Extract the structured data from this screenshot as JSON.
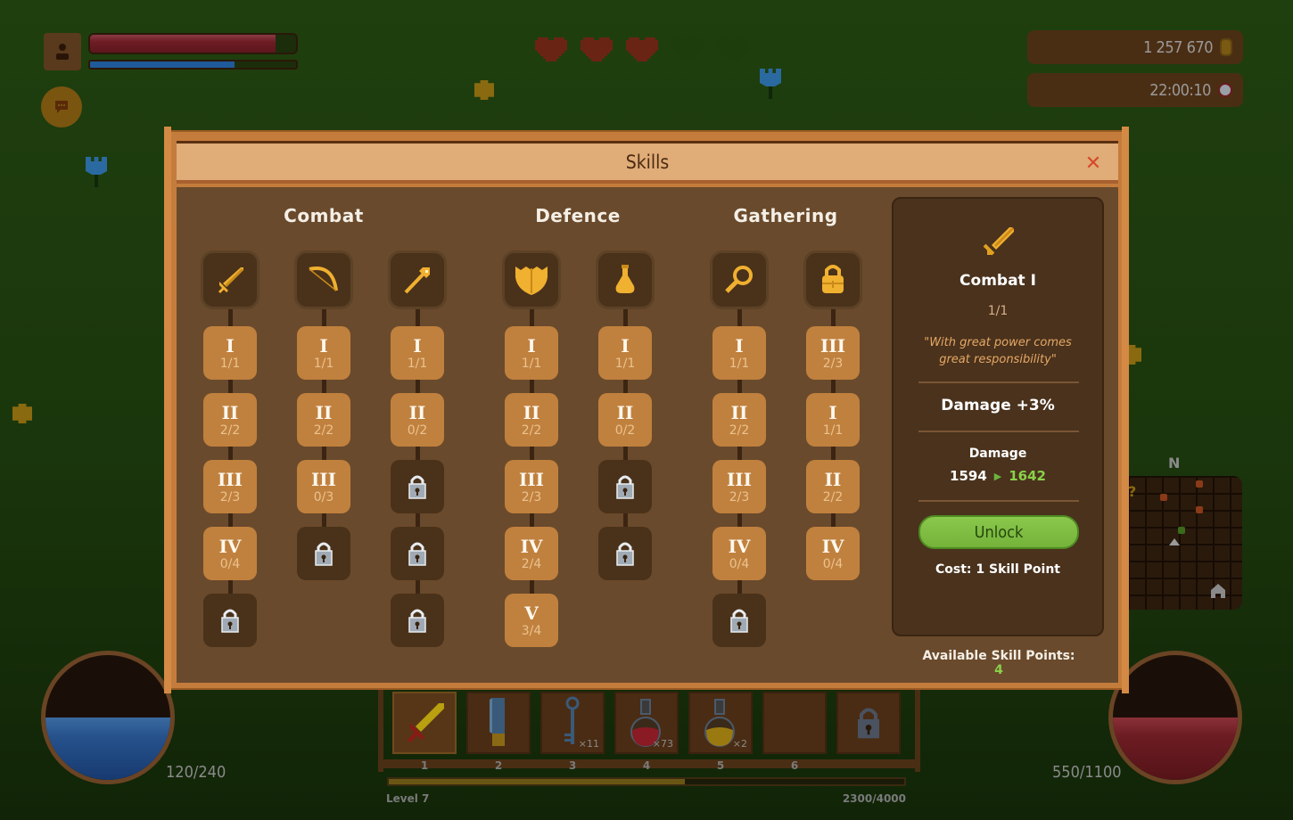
{
  "hud": {
    "health_fraction": 0.9,
    "mana_fraction": 0.7,
    "hearts": {
      "filled": 3,
      "total": 5
    },
    "gold": "1 257 670",
    "time": "22:00:10",
    "colors": {
      "health": "#6e1c24",
      "mana": "#1f5a9a",
      "heart_full": "#6a2414",
      "heart_empty": "#1d3d0c"
    }
  },
  "modal": {
    "title": "Skills",
    "close_label": "✕",
    "trees": [
      {
        "name": "Combat",
        "columns": [
          {
            "icon": "sword-icon",
            "nodes": [
              {
                "state": "unlocked",
                "rank": "I",
                "progress": "1/1"
              },
              {
                "state": "unlocked",
                "rank": "II",
                "progress": "2/2"
              },
              {
                "state": "unlocked",
                "rank": "III",
                "progress": "2/3"
              },
              {
                "state": "unlocked",
                "rank": "IV",
                "progress": "0/4"
              },
              {
                "state": "locked"
              }
            ]
          },
          {
            "icon": "bow-icon",
            "nodes": [
              {
                "state": "unlocked",
                "rank": "I",
                "progress": "1/1"
              },
              {
                "state": "unlocked",
                "rank": "II",
                "progress": "2/2"
              },
              {
                "state": "unlocked",
                "rank": "III",
                "progress": "0/3"
              },
              {
                "state": "locked"
              }
            ]
          },
          {
            "icon": "staff-icon",
            "nodes": [
              {
                "state": "unlocked",
                "rank": "I",
                "progress": "1/1"
              },
              {
                "state": "unlocked",
                "rank": "II",
                "progress": "0/2"
              },
              {
                "state": "locked"
              },
              {
                "state": "locked"
              },
              {
                "state": "locked"
              }
            ]
          }
        ]
      },
      {
        "name": "Defence",
        "columns": [
          {
            "icon": "shield-icon",
            "nodes": [
              {
                "state": "unlocked",
                "rank": "I",
                "progress": "1/1"
              },
              {
                "state": "unlocked",
                "rank": "II",
                "progress": "2/2"
              },
              {
                "state": "unlocked",
                "rank": "III",
                "progress": "2/3"
              },
              {
                "state": "unlocked",
                "rank": "IV",
                "progress": "2/4"
              },
              {
                "state": "unlocked",
                "rank": "V",
                "progress": "3/4"
              }
            ]
          },
          {
            "icon": "potion-icon",
            "nodes": [
              {
                "state": "unlocked",
                "rank": "I",
                "progress": "1/1"
              },
              {
                "state": "unlocked",
                "rank": "II",
                "progress": "0/2"
              },
              {
                "state": "locked"
              },
              {
                "state": "locked"
              }
            ]
          }
        ]
      },
      {
        "name": "Gathering",
        "columns": [
          {
            "icon": "magnifier-icon",
            "nodes": [
              {
                "state": "unlocked",
                "rank": "I",
                "progress": "1/1"
              },
              {
                "state": "unlocked",
                "rank": "II",
                "progress": "2/2"
              },
              {
                "state": "unlocked",
                "rank": "III",
                "progress": "2/3"
              },
              {
                "state": "unlocked",
                "rank": "IV",
                "progress": "0/4"
              },
              {
                "state": "locked"
              }
            ]
          },
          {
            "icon": "backpack-icon",
            "nodes": [
              {
                "state": "unlocked",
                "rank": "III",
                "progress": "2/3"
              },
              {
                "state": "unlocked",
                "rank": "I",
                "progress": "1/1"
              },
              {
                "state": "unlocked",
                "rank": "II",
                "progress": "2/2"
              },
              {
                "state": "unlocked",
                "rank": "IV",
                "progress": "0/4"
              }
            ]
          }
        ]
      }
    ],
    "detail": {
      "icon": "sword-icon",
      "name": "Combat I",
      "progress": "1/1",
      "quote": "\"With great power comes great responsibility\"",
      "effect": "Damage +3%",
      "stat_label": "Damage",
      "stat_old": "1594",
      "stat_arrow": "▶",
      "stat_new": "1642",
      "unlock_label": "Unlock",
      "cost": "Cost: 1 Skill Point"
    },
    "available_label": "Available Skill Points:",
    "available_value": "4"
  },
  "orbs": {
    "mana": {
      "text": "120/240",
      "fraction": 0.5
    },
    "health": {
      "text": "550/1100",
      "fraction": 0.5
    }
  },
  "hotbar": {
    "slots": [
      {
        "num": "1",
        "item": "sword-icon",
        "count": "",
        "selected": true
      },
      {
        "num": "2",
        "item": "saw-icon",
        "count": ""
      },
      {
        "num": "3",
        "item": "key-icon",
        "count": "×11"
      },
      {
        "num": "4",
        "item": "red-potion-icon",
        "count": "×73"
      },
      {
        "num": "5",
        "item": "yellow-potion-icon",
        "count": "×2"
      },
      {
        "num": "6",
        "item": "",
        "count": ""
      },
      {
        "num": "",
        "item": "lock-icon",
        "count": ""
      }
    ],
    "level": "Level 7",
    "xp": "2300/4000",
    "xp_fraction": 0.575
  },
  "minimap": {
    "north_label": "N"
  }
}
